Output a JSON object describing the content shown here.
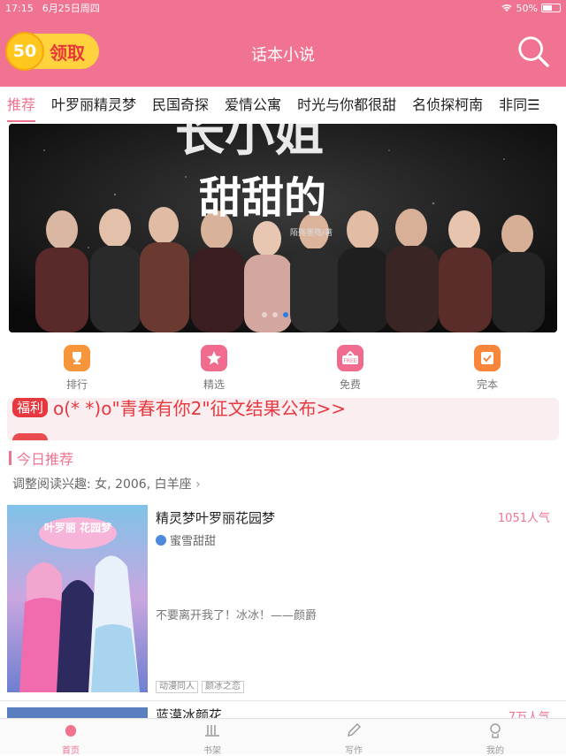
{
  "status": {
    "time": "17:15",
    "date": "6月25日周四",
    "battery": "50%",
    "battery_level": 0.5
  },
  "header": {
    "coin_value": "50",
    "coin_label": "领取",
    "title": "话本小说"
  },
  "tabs": [
    "推荐",
    "叶罗丽精灵梦",
    "民国奇探",
    "爱情公寓",
    "时光与你都很甜",
    "名侦探柯南",
    "非同"
  ],
  "banner": {
    "title": "甜甜的",
    "author": "陌殇墨殇/著",
    "active_dot": 2,
    "dot_count": 3
  },
  "quick": [
    {
      "label": "排行",
      "icon": "trophy-icon",
      "color": "#f7953a"
    },
    {
      "label": "精选",
      "icon": "star-icon",
      "color": "#f06b8e"
    },
    {
      "label": "免费",
      "icon": "free-icon",
      "color": "#f06b8e"
    },
    {
      "label": "完本",
      "icon": "check-icon",
      "color": "#f7853a"
    }
  ],
  "notices": [
    {
      "tag": "福利",
      "text": "o(*      *)o\"青春有你2\"征文结果公布>>"
    },
    {
      "tag": "",
      "text": ""
    }
  ],
  "section": {
    "title": "今日推荐",
    "interest": "调整阅读兴趣: 女, 2006, 白羊座"
  },
  "books": [
    {
      "title": "精灵梦叶罗丽花园梦",
      "popularity": "1051人气",
      "author": "蜜雪甜甜",
      "desc": "不要离开我了！冰冰！——颜爵",
      "tags": [
        "动漫同人",
        "颜冰之恋"
      ],
      "cover_text": "叶罗丽 花园梦"
    },
    {
      "title": "蓝漠冰颜花",
      "popularity": "7万人气"
    }
  ],
  "nav": [
    {
      "label": "首页",
      "icon": "home-icon"
    },
    {
      "label": "书架",
      "icon": "bookshelf-icon"
    },
    {
      "label": "写作",
      "icon": "pen-icon"
    },
    {
      "label": "我的",
      "icon": "profile-icon"
    }
  ],
  "colors": {
    "brand": "#f07391",
    "alert": "#e7383f",
    "coin": "#ffd23e"
  }
}
